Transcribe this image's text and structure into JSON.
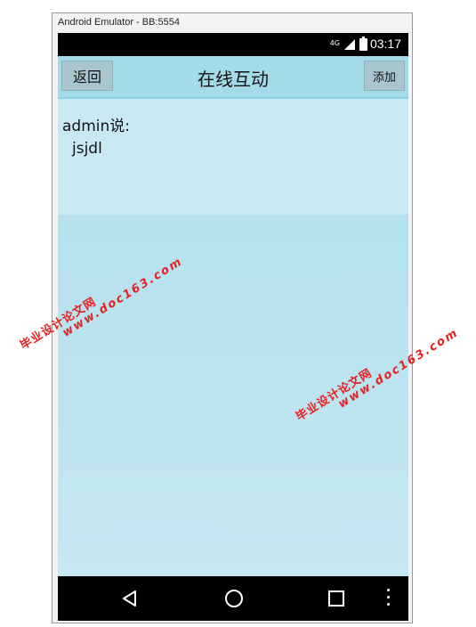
{
  "window": {
    "title": "Android Emulator - BB:5554"
  },
  "status_bar": {
    "network": "4G",
    "time": "03:17"
  },
  "header": {
    "back_label": "返回",
    "title": "在线互动",
    "add_label": "添加"
  },
  "messages": [
    {
      "user": "admin说:",
      "text": "jsjdl"
    }
  ],
  "nav_bar": {
    "icons": [
      "back-triangle-icon",
      "home-circle-icon",
      "recents-square-icon",
      "menu-dots-icon"
    ]
  },
  "watermarks": [
    {
      "cn": "毕业设计论文网",
      "url": "www.doc163.com"
    },
    {
      "cn": "毕业设计论文网",
      "url": "www.doc163.com"
    }
  ],
  "colors": {
    "header": "#a4dbe9",
    "content": "#b7e2ef",
    "message_bg": "#c9e9f2",
    "watermark": "#e82020"
  }
}
